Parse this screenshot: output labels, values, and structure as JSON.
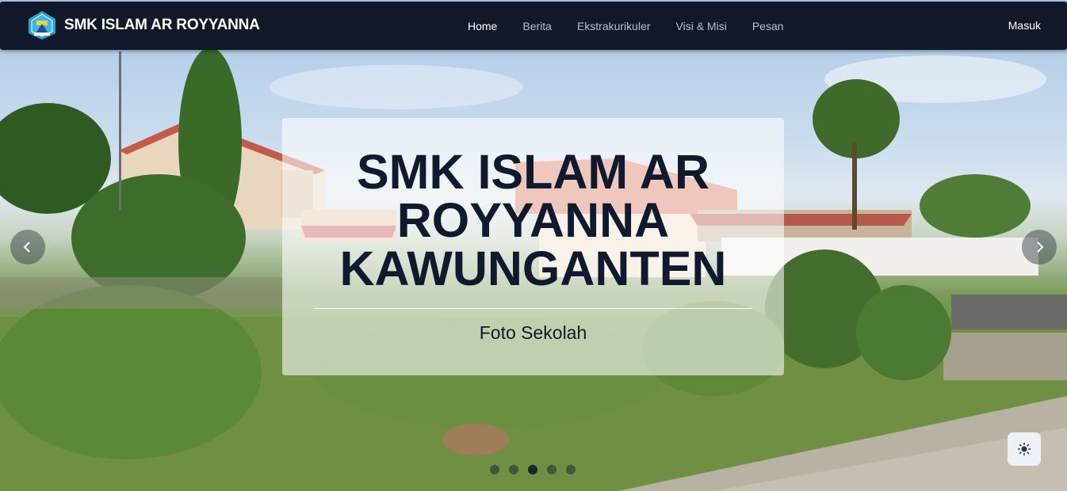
{
  "navbar": {
    "brand": "SMK ISLAM AR ROYYANNA",
    "links": [
      {
        "label": "Home",
        "active": true
      },
      {
        "label": "Berita",
        "active": false
      },
      {
        "label": "Ekstrakurikuler",
        "active": false
      },
      {
        "label": "Visi & Misi",
        "active": false
      },
      {
        "label": "Pesan",
        "active": false
      }
    ],
    "login": "Masuk"
  },
  "carousel": {
    "caption_title": "SMK ISLAM AR ROYYANNA KAWUNGANTEN",
    "caption_subtitle": "Foto Sekolah",
    "slide_count": 5,
    "active_slide": 3,
    "prev_icon": "chevron-left-icon",
    "next_icon": "chevron-right-icon"
  },
  "theme_toggle": {
    "icon": "sun-icon"
  },
  "colors": {
    "navbar_bg": "#111827",
    "caption_text": "#0f1a2e",
    "nav_active": "#ffffff",
    "nav_inactive": "#b8bfcb"
  }
}
